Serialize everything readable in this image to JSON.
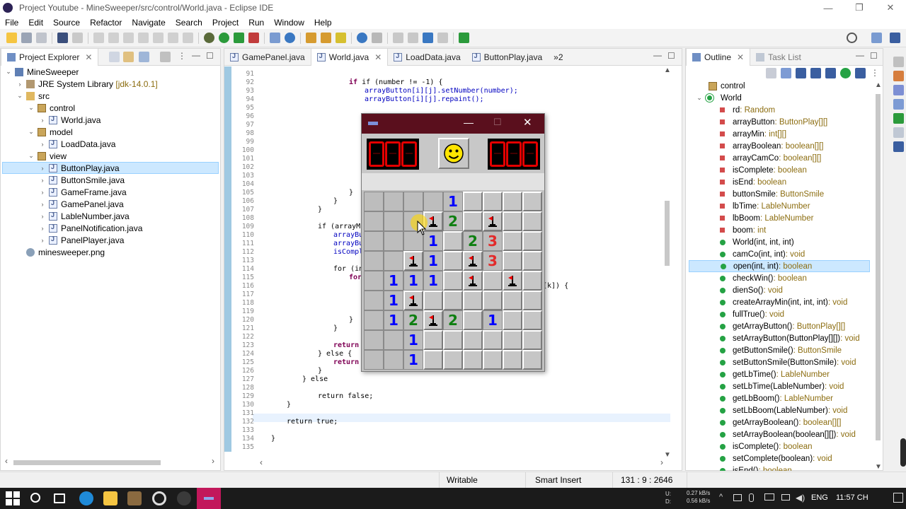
{
  "window": {
    "title": "Project Youtube - MineSweeper/src/control/World.java - Eclipse IDE",
    "minimize": "—",
    "restore": "❐",
    "close": "✕"
  },
  "menu": [
    "File",
    "Edit",
    "Source",
    "Refactor",
    "Navigate",
    "Search",
    "Project",
    "Run",
    "Window",
    "Help"
  ],
  "project_explorer": {
    "tab_label": "Project Explorer",
    "items": [
      {
        "label": "MineSweeper",
        "type": "project"
      },
      {
        "label": "JRE System Library",
        "suffix": "[jdk-14.0.1]",
        "type": "library"
      },
      {
        "label": "src",
        "type": "folder"
      },
      {
        "label": "control",
        "type": "package"
      },
      {
        "label": "World.java",
        "type": "java"
      },
      {
        "label": "model",
        "type": "package"
      },
      {
        "label": "LoadData.java",
        "type": "java"
      },
      {
        "label": "view",
        "type": "package"
      },
      {
        "label": "ButtonPlay.java",
        "type": "java",
        "selected": true
      },
      {
        "label": "ButtonSmile.java",
        "type": "java"
      },
      {
        "label": "GameFrame.java",
        "type": "java"
      },
      {
        "label": "GamePanel.java",
        "type": "java"
      },
      {
        "label": "LableNumber.java",
        "type": "java"
      },
      {
        "label": "PanelNotification.java",
        "type": "java"
      },
      {
        "label": "PanelPlayer.java",
        "type": "java"
      },
      {
        "label": "minesweeper.png",
        "type": "image"
      }
    ]
  },
  "editor": {
    "tabs": [
      {
        "label": "GamePanel.java"
      },
      {
        "label": "World.java",
        "active": true
      },
      {
        "label": "LoadData.java"
      },
      {
        "label": "ButtonPlay.java"
      },
      {
        "label": "»2"
      }
    ],
    "line_numbers": [
      "91",
      "92",
      "93",
      "94",
      "95",
      "96",
      "97",
      "98",
      "99",
      "100",
      "101",
      "102",
      "103",
      "104",
      "105",
      "106",
      "107",
      "108",
      "109",
      "110",
      "111",
      "112",
      "113",
      "114",
      "115",
      "116",
      "117",
      "118",
      "119",
      "120",
      "121",
      "122",
      "123",
      "124",
      "125",
      "126",
      "127",
      "128",
      "129",
      "130",
      "131",
      "132",
      "133",
      "134",
      "135"
    ],
    "code": {
      "l92": "if (number != -1) {",
      "l93": "arrayButton[i][j].setNumber(number);",
      "l94": "arrayButton[i][j].repaint();",
      "l105": "}",
      "l106": "}",
      "l107": "}",
      "l109": "if (arrayMi",
      "l110": "arrayBut",
      "l111": "arrayBut",
      "l112": "isComple",
      "l114": "for (in",
      "l115": "for",
      "l116": "[k]) {",
      "l120": "}",
      "l121": "}",
      "l123": "return",
      "l124": "} else {",
      "l125": "return",
      "l126": "}",
      "l127": "} else",
      "l129": "return false;",
      "l130": "}",
      "l132": "return true;",
      "l134": "}"
    }
  },
  "minesweeper": {
    "title_icon": "java-icon",
    "left_counter": "000",
    "right_counter": "000",
    "smile": "smiley-face",
    "grid": [
      [
        "c",
        "c",
        "c",
        "c",
        "1",
        "o",
        "o",
        "o",
        "o"
      ],
      [
        "c",
        "c",
        "c",
        "f",
        "2",
        "o",
        "f",
        "o",
        "o"
      ],
      [
        "c",
        "c",
        "c",
        "1",
        "o",
        "2",
        "3",
        "o",
        "o"
      ],
      [
        "c",
        "c",
        "f",
        "1",
        "o",
        "f",
        "3",
        "o",
        "o"
      ],
      [
        "c",
        "1",
        "1",
        "1",
        "o",
        "f",
        "o",
        "f",
        "o"
      ],
      [
        "c",
        "1",
        "f",
        "o",
        "o",
        "o",
        "o",
        "o",
        "o"
      ],
      [
        "c",
        "1",
        "2",
        "f",
        "2",
        "o",
        "1",
        "o",
        "o"
      ],
      [
        "c",
        "c",
        "1",
        "o",
        "o",
        "o",
        "o",
        "o",
        "o"
      ],
      [
        "c",
        "c",
        "1",
        "o",
        "o",
        "o",
        "o",
        "o",
        "o"
      ]
    ]
  },
  "outline": {
    "tabs": [
      {
        "label": "Outline"
      },
      {
        "label": "Task List"
      }
    ],
    "items": [
      {
        "name": "control",
        "type": "",
        "kind": "package"
      },
      {
        "name": "World",
        "type": "",
        "kind": "class"
      },
      {
        "name": "rd",
        "type": " : Random",
        "kind": "field"
      },
      {
        "name": "arrayButton",
        "type": " : ButtonPlay[][]",
        "kind": "field"
      },
      {
        "name": "arrayMin",
        "type": " : int[][]",
        "kind": "field"
      },
      {
        "name": "arrayBoolean",
        "type": " : boolean[][]",
        "kind": "field"
      },
      {
        "name": "arrayCamCo",
        "type": " : boolean[][]",
        "kind": "field"
      },
      {
        "name": "isComplete",
        "type": " : boolean",
        "kind": "field"
      },
      {
        "name": "isEnd",
        "type": " : boolean",
        "kind": "field"
      },
      {
        "name": "buttonSmile",
        "type": " : ButtonSmile",
        "kind": "field"
      },
      {
        "name": "lbTime",
        "type": " : LableNumber",
        "kind": "field"
      },
      {
        "name": "lbBoom",
        "type": " : LableNumber",
        "kind": "field"
      },
      {
        "name": "boom",
        "type": " : int",
        "kind": "field"
      },
      {
        "name": "World(int, int, int)",
        "type": "",
        "kind": "method"
      },
      {
        "name": "camCo(int, int)",
        "type": " : void",
        "kind": "method"
      },
      {
        "name": "open(int, int)",
        "type": " : boolean",
        "kind": "method",
        "selected": true
      },
      {
        "name": "checkWin()",
        "type": " : boolean",
        "kind": "method"
      },
      {
        "name": "dienSo()",
        "type": " : void",
        "kind": "method"
      },
      {
        "name": "createArrayMin(int, int, int)",
        "type": " : void",
        "kind": "method"
      },
      {
        "name": "fullTrue()",
        "type": " : void",
        "kind": "method"
      },
      {
        "name": "getArrayButton()",
        "type": " : ButtonPlay[][]",
        "kind": "method"
      },
      {
        "name": "setArrayButton(ButtonPlay[][])",
        "type": " : void",
        "kind": "method"
      },
      {
        "name": "getButtonSmile()",
        "type": " : ButtonSmile",
        "kind": "method"
      },
      {
        "name": "setButtonSmile(ButtonSmile)",
        "type": " : void",
        "kind": "method"
      },
      {
        "name": "getLbTime()",
        "type": " : LableNumber",
        "kind": "method"
      },
      {
        "name": "setLbTime(LableNumber)",
        "type": " : void",
        "kind": "method"
      },
      {
        "name": "getLbBoom()",
        "type": " : LableNumber",
        "kind": "method"
      },
      {
        "name": "setLbBoom(LableNumber)",
        "type": " : void",
        "kind": "method"
      },
      {
        "name": "getArrayBoolean()",
        "type": " : boolean[][]",
        "kind": "method"
      },
      {
        "name": "setArrayBoolean(boolean[][])",
        "type": " : void",
        "kind": "method"
      },
      {
        "name": "isComplete()",
        "type": " : boolean",
        "kind": "method"
      },
      {
        "name": "setComplete(boolean)",
        "type": " : void",
        "kind": "method"
      },
      {
        "name": "isEnd()",
        "type": " : boolean",
        "kind": "method"
      }
    ]
  },
  "status": {
    "writable": "Writable",
    "insert_mode": "Smart Insert",
    "position": "131 : 9 : 2646"
  },
  "taskbar": {
    "net_up": "0.27 kB/s",
    "net_down": "0.56 kB/s",
    "drive_u": "U:",
    "drive_d": "D:",
    "lang": "ENG",
    "time": "11:57 CH"
  },
  "colors": {
    "accent_selection": "#cce8ff",
    "number_blue": "#0000ff",
    "number_green": "#0f7f12",
    "number_red": "#e22b2b",
    "taskbar": "#1b1b1b"
  }
}
